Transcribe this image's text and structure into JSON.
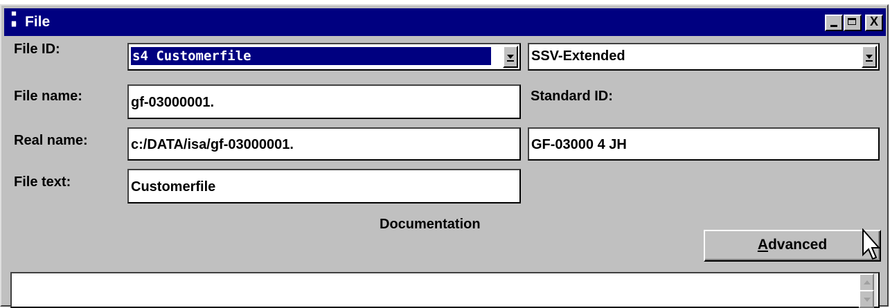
{
  "window": {
    "title": "File",
    "system_icon": "document-menu-icon",
    "controls": {
      "minimize": "minimize-icon",
      "maximize": "maximize-icon",
      "close": "X"
    }
  },
  "form": {
    "file_id": {
      "label": "File ID:",
      "value": "s4  Customerfile"
    },
    "file_type": {
      "value": "SSV-Extended"
    },
    "file_name": {
      "label": "File name:",
      "value": "gf-03000001."
    },
    "standard_id": {
      "label": "Standard ID:",
      "value": "GF-03000   4 JH"
    },
    "real_name": {
      "label": "Real name:",
      "value": "c:/DATA/isa/gf-03000001."
    },
    "file_text": {
      "label": "File text:",
      "value": "Customerfile"
    },
    "documentation": {
      "label": "Documentation",
      "value": ""
    }
  },
  "buttons": {
    "advanced_prefix": "A",
    "advanced_rest": "dvanced"
  },
  "colors": {
    "titlebar": "#000080",
    "face": "#c0c0c0",
    "selection": "#000080"
  }
}
